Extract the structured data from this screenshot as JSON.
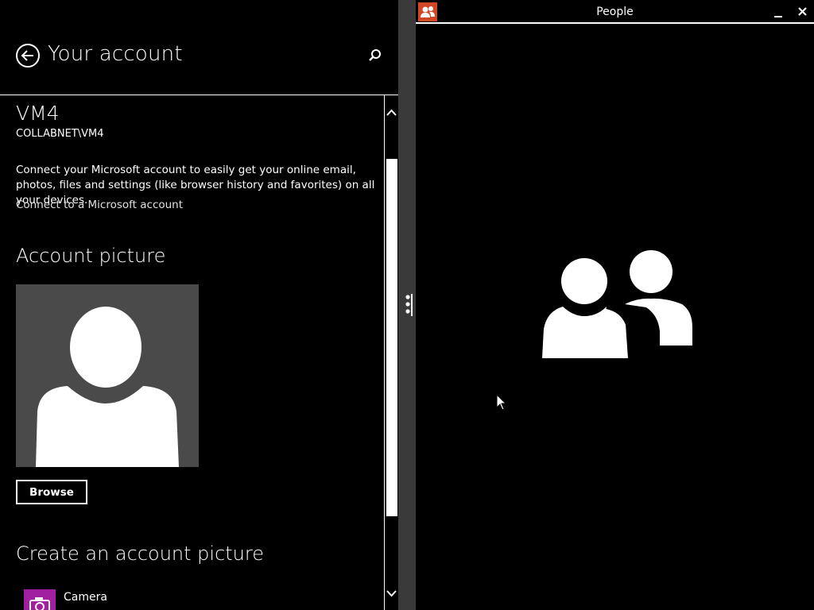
{
  "settings": {
    "header_title": "Your account",
    "user_name": "VM4",
    "user_domain": "COLLABNET\\VM4",
    "connect_description": "Connect your Microsoft account to easily get your online email, photos, files and settings (like browser history and favorites) on all your devices.",
    "connect_link": "Connect to a Microsoft account",
    "account_picture_heading": "Account picture",
    "browse_label": "Browse",
    "create_picture_heading": "Create an account picture",
    "camera_label": "Camera",
    "icons": {
      "back": "back-arrow-icon",
      "search": "search-icon",
      "camera": "camera-icon"
    }
  },
  "people_app": {
    "title": "People",
    "icons": {
      "app": "people-icon",
      "minimize": "minimize-icon",
      "close": "close-icon",
      "logo": "people-logo-icon"
    }
  },
  "colors": {
    "background": "#000000",
    "picture_bg": "#4a4a4a",
    "people_accent": "#d24726",
    "camera_accent": "#a020a0",
    "splitter": "#3a3a3a"
  }
}
